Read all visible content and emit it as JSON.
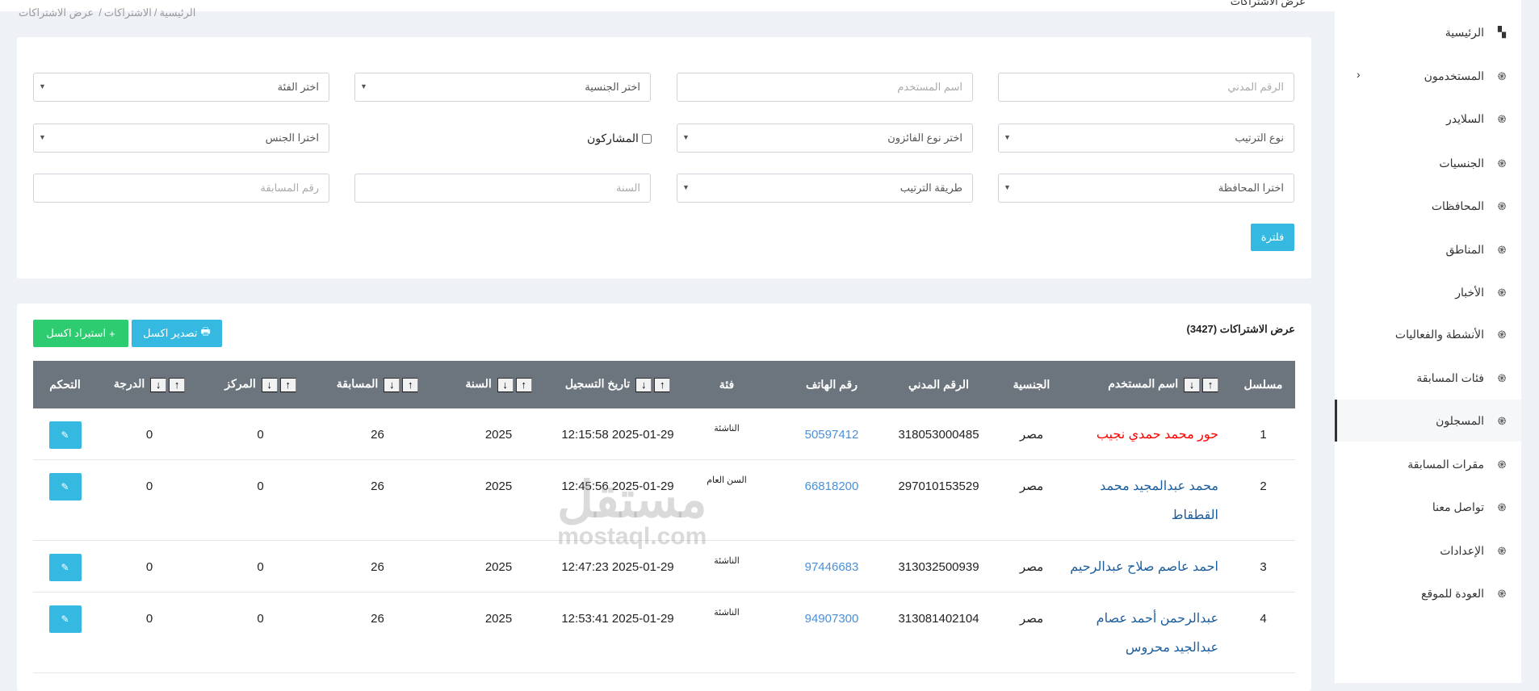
{
  "header": {
    "title": "عرض الاشتراكات",
    "breadcrumb": [
      "الرئيسية",
      "الاشتراكات",
      "عرض الاشتراكات"
    ]
  },
  "sidebar": {
    "items": [
      {
        "label": "الرئيسية",
        "icon": "dashboard-icon"
      },
      {
        "label": "المستخدمون",
        "icon": "atom-icon",
        "has_submenu": true
      },
      {
        "label": "السلايدر",
        "icon": "atom-icon"
      },
      {
        "label": "الجنسيات",
        "icon": "atom-icon"
      },
      {
        "label": "المحافظات",
        "icon": "atom-icon"
      },
      {
        "label": "المناطق",
        "icon": "atom-icon"
      },
      {
        "label": "الأخبار",
        "icon": "atom-icon"
      },
      {
        "label": "الأنشطة والفعاليات",
        "icon": "atom-icon"
      },
      {
        "label": "فئات المسابقة",
        "icon": "atom-icon"
      },
      {
        "label": "المسجلون",
        "icon": "atom-icon",
        "active": true
      },
      {
        "label": "مقرات المسابقة",
        "icon": "atom-icon"
      },
      {
        "label": "تواصل معنا",
        "icon": "atom-icon"
      },
      {
        "label": "الإعدادات",
        "icon": "atom-icon"
      },
      {
        "label": "العودة للموقع",
        "icon": "atom-icon"
      }
    ]
  },
  "filters": {
    "civil_id_placeholder": "الرقم المدني",
    "username_placeholder": "اسم المستخدم",
    "nationality_select": "اختر الجنسية",
    "category_select": "اختر الفئة",
    "sort_type_select": "نوع الترتيب",
    "winner_type_select": "اختر نوع الفائزون",
    "participants_checkbox": "المشاركون",
    "gender_select": "اخترا الجنس",
    "governorate_select": "اخترا المحافظة",
    "sort_method_select": "طريقة الترتيب",
    "year_placeholder": "السنة",
    "competition_no_placeholder": "رقم المسابقة",
    "filter_button": "فلترة"
  },
  "table_card": {
    "title": "عرض الاشتراكات (3427)",
    "export_button": "تصدير اكسل",
    "import_button": "استيراد اكسل",
    "sort_up": "↑",
    "sort_down": "↓",
    "columns": [
      "مسلسل",
      "اسم المستخدم",
      "الجنسية",
      "الرقم المدني",
      "رقم الهاتف",
      "فئة",
      "تاريخ التسجيل",
      "السنة",
      "المسابقة",
      "المركز",
      "الدرجة",
      "التحكم"
    ],
    "rows": [
      {
        "serial": "1",
        "name": "حور محمد حمدي نجيب",
        "highlight": true,
        "nationality": "مصر",
        "civil_id": "318053000485",
        "phone": "50597412",
        "category": "الناشئة",
        "date": "2025-01-29 12:15:58",
        "year": "2025",
        "competition": "26",
        "rank": "0",
        "score": "0"
      },
      {
        "serial": "2",
        "name": "محمد عبدالمجيد محمد القطقاط",
        "nationality": "مصر",
        "civil_id": "297010153529",
        "phone": "66818200",
        "category": "السن العام",
        "date": "2025-01-29 12:45:56",
        "year": "2025",
        "competition": "26",
        "rank": "0",
        "score": "0"
      },
      {
        "serial": "3",
        "name": "احمد عاصم صلاح عبدالرحيم",
        "nationality": "مصر",
        "civil_id": "313032500939",
        "phone": "97446683",
        "category": "الناشئة",
        "date": "2025-01-29 12:47:23",
        "year": "2025",
        "competition": "26",
        "rank": "0",
        "score": "0"
      },
      {
        "serial": "4",
        "name": "عبدالرحمن أحمد عصام عبدالجيد محروس",
        "nationality": "مصر",
        "civil_id": "313081402104",
        "phone": "94907300",
        "category": "الناشئة",
        "date": "2025-01-29 12:53:41",
        "year": "2025",
        "competition": "26",
        "rank": "0",
        "score": "0"
      }
    ]
  },
  "watermark": {
    "ar": "مستقل",
    "en": "mostaql.com"
  },
  "colors": {
    "header_bg": "#6c757d",
    "primary": "#36b9e1",
    "success": "#2ecc71",
    "highlight_name": "#ff0000",
    "link": "#1b5e9e"
  }
}
